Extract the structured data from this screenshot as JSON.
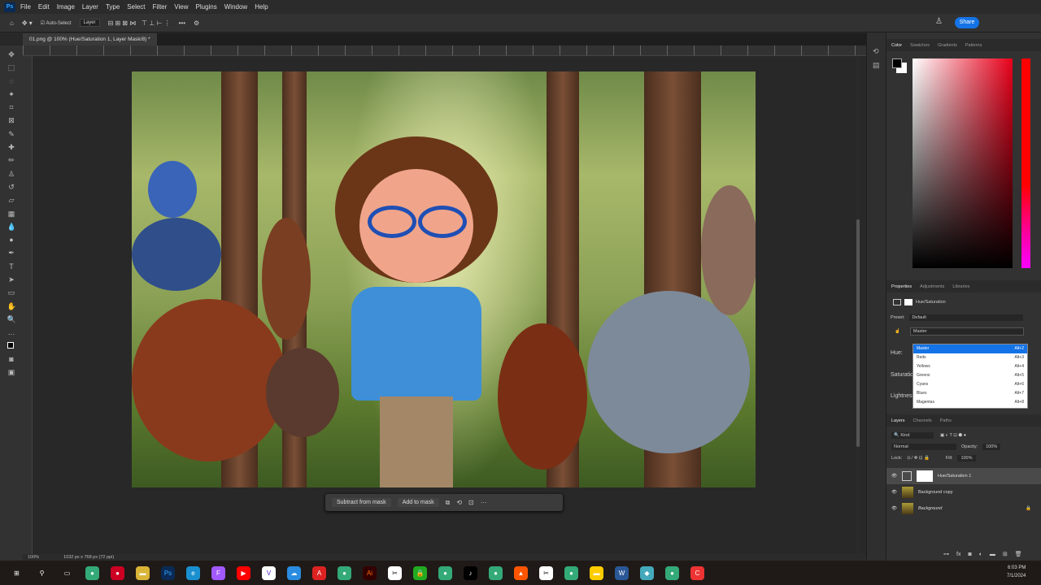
{
  "app": {
    "logo": "Ps"
  },
  "menu": [
    "File",
    "Edit",
    "Image",
    "Layer",
    "Type",
    "Select",
    "Filter",
    "View",
    "Plugins",
    "Window",
    "Help"
  ],
  "options": {
    "auto_select": "Auto-Select",
    "layer_select": "Layer",
    "share": "Share"
  },
  "document": {
    "tab": "01.png @ 100% (Hue/Saturation 1, Layer Mask/8) *",
    "zoom": "100%",
    "dimensions": "1032 px x 768 px (72 ppi)"
  },
  "context_bar": {
    "subtract": "Subtract from mask",
    "add": "Add to mask"
  },
  "color_panel": {
    "tabs": [
      "Color",
      "Swatches",
      "Gradients",
      "Patterns"
    ],
    "hue_color": "#e8001a"
  },
  "properties": {
    "tabs": [
      "Properties",
      "Adjustments",
      "Libraries"
    ],
    "title": "Hue/Saturation",
    "preset_label": "Preset:",
    "preset_value": "Default",
    "channel_value": "Master",
    "labels": [
      "Hue:",
      "Saturation:",
      "Lightness:"
    ],
    "channel_options": [
      {
        "label": "Master",
        "shortcut": "Alt+2"
      },
      {
        "label": "Reds",
        "shortcut": "Alt+3"
      },
      {
        "label": "Yellows",
        "shortcut": "Alt+4"
      },
      {
        "label": "Greens",
        "shortcut": "Alt+5"
      },
      {
        "label": "Cyans",
        "shortcut": "Alt+6"
      },
      {
        "label": "Blues",
        "shortcut": "Alt+7"
      },
      {
        "label": "Magentas",
        "shortcut": "Alt+8"
      }
    ]
  },
  "layers_panel": {
    "tabs": [
      "Layers",
      "Channels",
      "Paths"
    ],
    "filter": "Kind",
    "blend_mode": "Normal",
    "opacity_label": "Opacity:",
    "opacity": "100%",
    "lock_label": "Lock:",
    "fill_label": "Fill:",
    "fill": "100%",
    "layers": [
      {
        "name": "Hue/Saturation 1"
      },
      {
        "name": "Background copy"
      },
      {
        "name": "Background"
      }
    ]
  },
  "taskbar": {
    "time": "6:03 PM",
    "date": "7/1/2024"
  }
}
